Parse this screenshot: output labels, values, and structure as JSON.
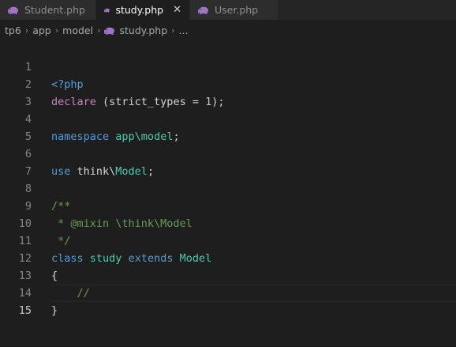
{
  "tabs": [
    {
      "label": "Student.php",
      "active": false,
      "icon": "php-icon"
    },
    {
      "label": "study.php",
      "active": true,
      "icon": "php-icon",
      "close": "✕"
    },
    {
      "label": "User.php",
      "active": false,
      "icon": "php-icon"
    }
  ],
  "breadcrumb": {
    "items": [
      "tp6",
      "app",
      "model",
      "study.php",
      "..."
    ],
    "separator": "›"
  },
  "editor": {
    "line_numbers": [
      "1",
      "2",
      "3",
      "4",
      "5",
      "6",
      "7",
      "8",
      "9",
      "10",
      "11",
      "12",
      "13",
      "14",
      "15"
    ],
    "current_line": "15",
    "lines": {
      "l1": [
        "<?php"
      ],
      "l2": [
        "declare",
        " (strict_types = ",
        "1",
        ");"
      ],
      "l4": [
        "namespace",
        " ",
        "app\\model",
        ";"
      ],
      "l6": [
        "use",
        " think\\",
        "Model",
        ";"
      ],
      "l8": [
        "/**"
      ],
      "l9": [
        " * @mixin \\think\\Model"
      ],
      "l10": [
        " */"
      ],
      "l11": [
        "class",
        " ",
        "study",
        " ",
        "extends",
        " ",
        "Model"
      ],
      "l12": [
        "{"
      ],
      "l13": [
        "    //"
      ],
      "l14": [
        "}"
      ]
    }
  },
  "colors": {
    "background": "#1e1e1e",
    "keyword": "#569cd6",
    "type": "#4ec9b0",
    "comment": "#6a9955",
    "number": "#b5cea8",
    "php_icon": "#a074c4"
  }
}
